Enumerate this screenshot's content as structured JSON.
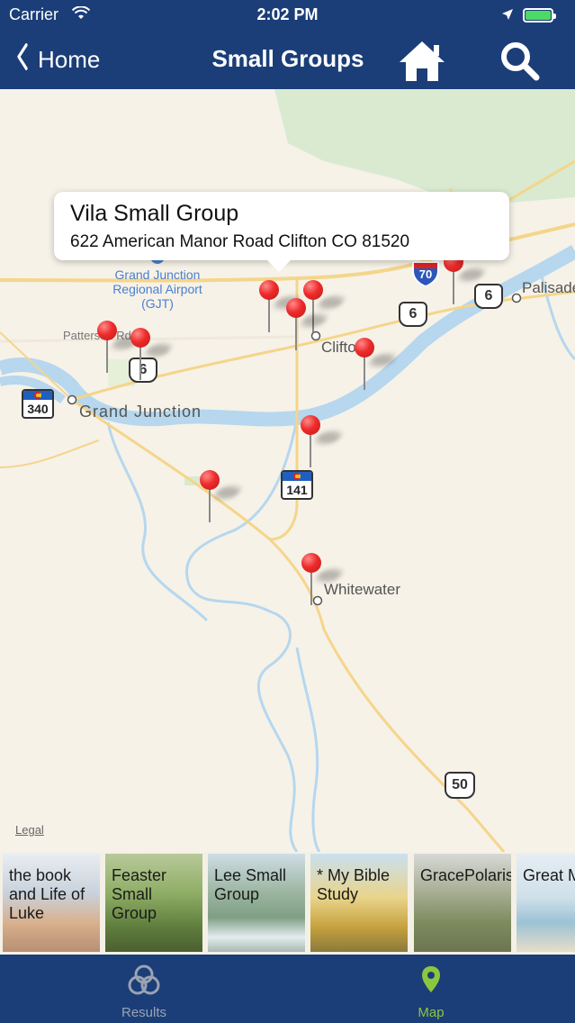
{
  "status_bar": {
    "carrier": "Carrier",
    "time": "2:02 PM"
  },
  "nav_bar": {
    "back_label": "Home",
    "title": "Small Groups",
    "home_icon": "home-icon",
    "search_icon": "search-icon"
  },
  "map": {
    "labels": {
      "palisade": "Palisade",
      "patterson": "Patterson Rd",
      "clifton": "Clifton",
      "grand_junction": "Grand Junction",
      "whitewater": "Whitewater",
      "airport": "Grand Junction Regional Airport (GJT)",
      "legal": "Legal"
    },
    "shields": {
      "i70": "70",
      "us6_a": "6",
      "us6_b": "6",
      "us6_c": "6",
      "co340": "340",
      "co141": "141",
      "us50": "50"
    },
    "callout": {
      "title": "Vila Small Group",
      "address": "622 American Manor Road Clifton CO 81520"
    },
    "pin_color": "#e22b2b"
  },
  "carousel": {
    "cards": [
      {
        "label": "the book and Life of Luke"
      },
      {
        "label": "Feaster Small Group"
      },
      {
        "label": "Lee Small Group"
      },
      {
        "label": "* My Bible Study"
      },
      {
        "label": "GracePolaris"
      },
      {
        "label": "Great M of the F"
      }
    ]
  },
  "tab_bar": {
    "tabs": [
      {
        "label": "Results",
        "icon": "rings-icon",
        "active": false
      },
      {
        "label": "Map",
        "icon": "map-pin-icon",
        "active": true
      }
    ],
    "active_color": "#8cc63f",
    "inactive_color": "#9aa3b4"
  },
  "colors": {
    "nav_bg": "#1b3e78",
    "map_bg": "#f6f2e8",
    "water": "#b6d7ee",
    "road": "#f5d58a"
  }
}
